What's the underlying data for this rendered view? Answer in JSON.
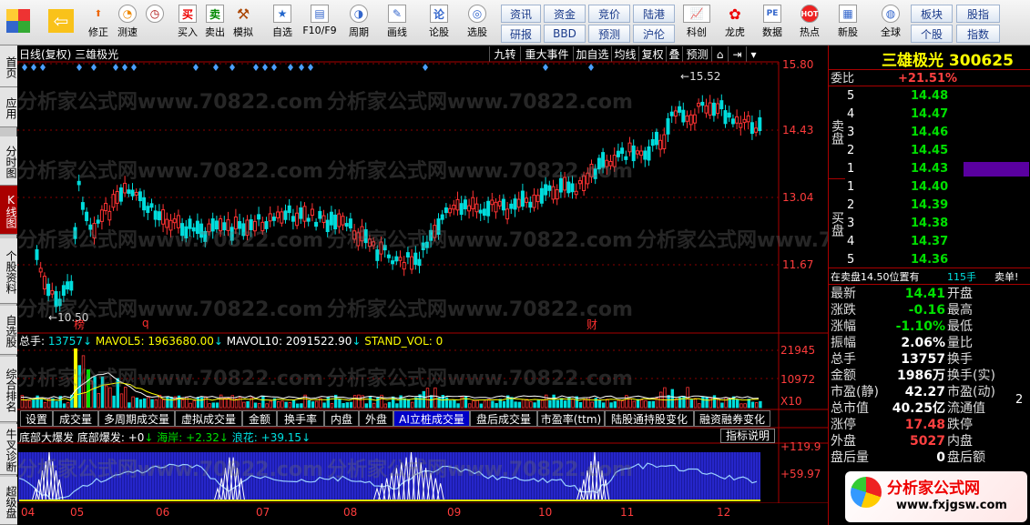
{
  "toolbar": {
    "items": [
      {
        "name": "windows-logo",
        "label": ""
      },
      {
        "name": "back",
        "label": ""
      },
      {
        "name": "repair",
        "label": "修正"
      },
      {
        "name": "speedtest",
        "label": "测速"
      },
      {
        "name": "buy",
        "label": "买入",
        "icon": "买"
      },
      {
        "name": "sell",
        "label": "卖出",
        "icon": "卖"
      },
      {
        "name": "simulate",
        "label": "模拟"
      },
      {
        "name": "self-select",
        "label": "自选"
      },
      {
        "name": "f10",
        "label": "F10/F9"
      },
      {
        "name": "period",
        "label": "周期"
      },
      {
        "name": "draw-line",
        "label": "画线"
      },
      {
        "name": "lun-gu",
        "label": "论股",
        "icon": "论"
      },
      {
        "name": "xuan-gu",
        "label": "选股"
      }
    ],
    "panel_buttons": [
      "资讯",
      "资金",
      "竞价",
      "陆港",
      "研报",
      "BBD",
      "预测",
      "沪伦"
    ],
    "right_icons": [
      {
        "name": "keke",
        "label": "科创"
      },
      {
        "name": "longhu",
        "label": "龙虎"
      },
      {
        "name": "data",
        "label": "数据",
        "icon": "PE"
      },
      {
        "name": "hot",
        "label": "热点",
        "icon": "HOT"
      },
      {
        "name": "new-stock",
        "label": "新股"
      },
      {
        "name": "global",
        "label": "全球"
      }
    ],
    "far_right": [
      "板块",
      "股指",
      "个股",
      "指数"
    ]
  },
  "side_tabs": [
    "首页",
    "应用",
    "分时图",
    "K线图",
    "个股资料",
    "自选股",
    "综合排名",
    "牛叉诊断",
    "超级盘"
  ],
  "chart_header": {
    "left": "日线(复权)  三雄极光",
    "menu": [
      "九转",
      "重大事件",
      "加自选",
      "均线",
      "复权",
      "叠",
      "预测"
    ]
  },
  "price_axis": [
    "15.80",
    "14.43",
    "13.04",
    "11.67"
  ],
  "price_marks": {
    "high": "15.52",
    "low": "10.50"
  },
  "event_markers": [
    "榜",
    "q",
    "财"
  ],
  "volume_header": {
    "total_label": "总手: ",
    "total": "13757",
    "mavol5_label": "MAVOL5: ",
    "mavol5": "1963680.00",
    "mavol10_label": "MAVOL10: ",
    "mavol10": "2091522.90",
    "std_label": "STAND_VOL: ",
    "std": "0"
  },
  "volume_axis": [
    "21945",
    "10972",
    "X10"
  ],
  "volume_tabs": [
    "设置",
    "成交量",
    "多周期成交量",
    "虚拟成交量",
    "金额",
    "换手率",
    "内盘",
    "外盘",
    "AI立桩成交量",
    "盘后成交量",
    "市盈率(ttm)",
    "陆股通持股变化",
    "融资融券变化"
  ],
  "indicator": {
    "title": "底部大爆发",
    "p1_label": "底部爆发: ",
    "p1": "+0",
    "p2_label": "海岸: ",
    "p2": "+2.32",
    "p3_label": "浪花: ",
    "p3": "+39.15",
    "help": "指标说明",
    "axis": [
      "+119.9",
      "+59.97"
    ]
  },
  "x_axis": [
    "04",
    "05",
    "06",
    "07",
    "08",
    "09",
    "10",
    "11",
    "12"
  ],
  "quote": {
    "name": "三雄极光",
    "code": "300625",
    "wei_bi_label": "委比",
    "wei_bi": "+21.51%",
    "sell_label": "卖盘",
    "buy_label": "买盘",
    "asks": [
      [
        "5",
        "14.48"
      ],
      [
        "4",
        "14.47"
      ],
      [
        "3",
        "14.46"
      ],
      [
        "2",
        "14.45"
      ],
      [
        "1",
        "14.43"
      ]
    ],
    "bids": [
      [
        "1",
        "14.40"
      ],
      [
        "2",
        "14.39"
      ],
      [
        "3",
        "14.38"
      ],
      [
        "4",
        "14.37"
      ],
      [
        "5",
        "14.36"
      ]
    ],
    "note_left": "在卖盘14.50位置有",
    "note_vol": "115手",
    "note_right": "卖单!",
    "stats": [
      {
        "l": "最新",
        "v": "14.41",
        "r": "开盘"
      },
      {
        "l": "涨跌",
        "v": "-0.16",
        "r": "最高"
      },
      {
        "l": "涨幅",
        "v": "-1.10%",
        "r": "最低"
      },
      {
        "l": "振幅",
        "v": "2.06%",
        "r": "量比"
      },
      {
        "l": "总手",
        "v": "13757",
        "r": "换手"
      },
      {
        "l": "金额",
        "v": "1986万",
        "r": "换手(实)"
      },
      {
        "l": "市盈(静)",
        "v": "42.27",
        "r": "市盈(动)"
      },
      {
        "l": "总市值",
        "v": "40.25亿",
        "r": "流通值"
      },
      {
        "l": "涨停",
        "v": "17.48",
        "r": "跌停"
      },
      {
        "l": "外盘",
        "v": "5027",
        "r": "内盘"
      },
      {
        "l": "盘后量",
        "v": "0",
        "r": "盘后额"
      }
    ],
    "liutong_suffix": "2"
  },
  "watermark": {
    "text": "分析家公式网www.70822.com",
    "logo_cn": "分析家公式网",
    "logo_url": "www.fxjgsw.com"
  },
  "colors": {
    "up": "#ff3333",
    "down": "#00dddd",
    "bg": "#000000",
    "accent": "#a00000"
  }
}
